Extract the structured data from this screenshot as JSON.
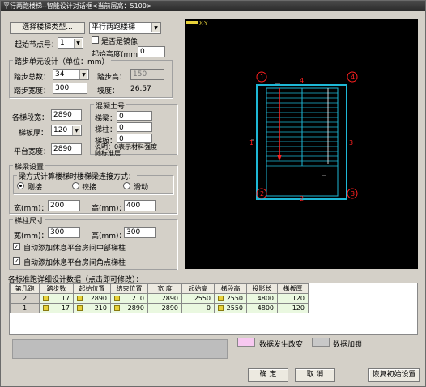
{
  "title": "平行两跑楼梯--智能设计对话框<当前层高：5100>",
  "top": {
    "choose_btn": "选择楼梯类型...",
    "stair_type": "平行两跑楼梯",
    "start_node_label": "起始节点号：",
    "start_node_value": "1",
    "mirror_label": "是否是镜像",
    "start_height_label": "起始高度(mm)",
    "start_height_value": "0"
  },
  "step_group": {
    "legend": "踏步单元设计（单位：mm）",
    "total_label": "踏步总数：",
    "total_value": "34",
    "height_label": "踏步高：",
    "height_value": "150",
    "width_label": "踏步宽度：",
    "width_value": "300",
    "slope_label": "坡度：",
    "slope_value": "26.57"
  },
  "left_fields": {
    "seg_width_label": "各梯段宽：",
    "seg_width_value": "2890",
    "slab_label": "梯板厚：",
    "slab_value": "120",
    "platform_label": "平台宽度：",
    "platform_value": "2890"
  },
  "concrete": {
    "legend": "混凝土号",
    "beam_label": "梯梁：",
    "beam_value": "0",
    "column_label": "梯柱：",
    "column_value": "0",
    "slab_label": "梯板：",
    "slab_value": "0",
    "note1": "说明：0表示材料强度",
    "note2": "随标准层"
  },
  "beam": {
    "legend": "梯梁设置",
    "sub_legend": "梁方式计算楼梯时楼梯梁连接方式：",
    "radio1": "刚接",
    "radio2": "铰接",
    "radio3": "滑动",
    "width_label": "宽(mm)：",
    "width_value": "200",
    "height_label": "高(mm)：",
    "height_value": "400"
  },
  "column": {
    "legend": "梯柱尺寸",
    "width_label": "宽(mm)：",
    "width_value": "300",
    "height_label": "高(mm)：",
    "height_value": "300",
    "auto1": "自动添加休息平台房间中部梯柱",
    "auto2": "自动添加休息平台房间角点梯柱"
  },
  "canvas": {
    "axis_label": "X-Y",
    "corner1": "①",
    "corner2": "②",
    "corner3": "③",
    "corner4": "④",
    "edge_top": "4",
    "edge_bottom": "2",
    "edge_left": "1",
    "edge_right": "3"
  },
  "table": {
    "caption": "各标准跑详细设计数据（点击即可修改）：",
    "headers": [
      "第几跑",
      "踏步数",
      "起始位置",
      "结束位置",
      "宽 度",
      "起始高",
      "梯段高",
      "投影长",
      "梯板厚"
    ],
    "rows": [
      [
        "2",
        "17",
        "2890",
        "210",
        "2890",
        "2550",
        "2550",
        "4800",
        "120"
      ],
      [
        "1",
        "17",
        "210",
        "2890",
        "2890",
        "0",
        "2550",
        "4800",
        "120"
      ]
    ]
  },
  "legend": {
    "changed": "数据发生改变",
    "locked": "数据加锁",
    "changed_color": "#f7c8f0",
    "locked_color": "#c8c8c8"
  },
  "buttons": {
    "ok": "确 定",
    "cancel": "取 消",
    "reset": "恢复初始设置"
  }
}
